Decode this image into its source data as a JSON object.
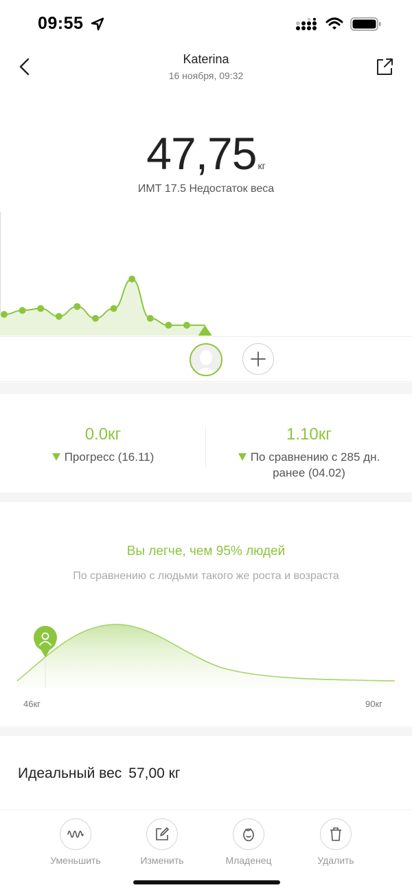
{
  "status": {
    "time": "09:55"
  },
  "header": {
    "title": "Katerina",
    "subtitle": "16 ноября, 09:32"
  },
  "weight": {
    "value": "47,75",
    "unit": "кг",
    "bmi_line": "ИМТ 17.5 Недостаток веса"
  },
  "trend": {
    "values": [
      48.3,
      48.5,
      48.6,
      48.2,
      48.7,
      48.1,
      48.6,
      50.1,
      48.1,
      47.75,
      47.75,
      47.75
    ]
  },
  "stats": [
    {
      "value": "0.0кг",
      "label": "Прогресс (16.11)"
    },
    {
      "value": "1.10кг",
      "label": "По сравнению с 285 дн. ранее (04.02)"
    }
  ],
  "compare": {
    "title": "Вы легче, чем 95% людей",
    "subtitle": "По сравнению с людьми такого же роста и возраста",
    "axis_min": "46кг",
    "axis_max": "90кг"
  },
  "ideal": {
    "label": "Идеальный вес",
    "value": "57,00 кг"
  },
  "toolbar": [
    {
      "label": "Уменьшить"
    },
    {
      "label": "Изменить"
    },
    {
      "label": "Младенец"
    },
    {
      "label": "Удалить"
    }
  ],
  "colors": {
    "accent": "#8cc63e",
    "fill": "#eaf4dd",
    "divider": "#f5f5f5"
  },
  "icons": [
    "location-arrow-icon",
    "signal-icon",
    "wifi-icon",
    "battery-icon",
    "back-icon",
    "share-icon",
    "avatar-icon",
    "plus-icon",
    "marker-person-icon",
    "wave-icon",
    "edit-icon",
    "baby-icon",
    "trash-icon"
  ]
}
